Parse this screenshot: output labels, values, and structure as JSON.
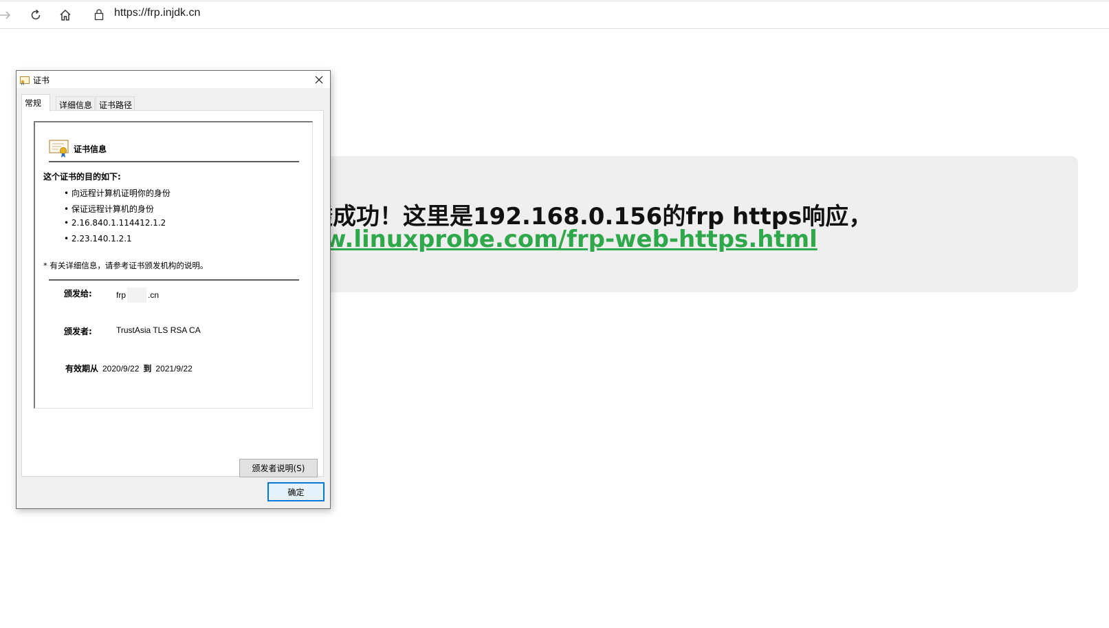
{
  "browser": {
    "url": "https://frp.injdk.cn"
  },
  "page": {
    "headline": "透成功！这里是192.168.0.156的frp https响应，",
    "link_text": "vw.linuxprobe.com/frp-web-https.html"
  },
  "dialog": {
    "title": "证书",
    "tabs": [
      {
        "label": "常规"
      },
      {
        "label": "详细信息"
      },
      {
        "label": "证书路径"
      }
    ],
    "info_title": "证书信息",
    "purpose_title": "这个证书的目的如下:",
    "purposes": [
      "• 向远程计算机证明你的身份",
      "• 保证远程计算机的身份",
      "• 2.16.840.1.114412.1.2",
      "• 2.23.140.1.2.1"
    ],
    "note": "* 有关详细信息，请参考证书颁发机构的说明。",
    "issued_to_label": "颁发给:",
    "issued_to_prefix": "frp",
    "issued_to_suffix": ".cn",
    "issued_by_label": "颁发者:",
    "issued_by_value": "TrustAsia TLS RSA CA",
    "valid_from_label": "有效期从",
    "valid_from": "2020/9/22",
    "valid_to_label": "到",
    "valid_to": "2021/9/22",
    "issuer_statement_button": "颁发者说明(S)",
    "ok_button": "确定"
  },
  "icons": {
    "back": "forward-arrow-icon",
    "refresh": "refresh-icon",
    "home": "home-icon",
    "lock": "lock-icon",
    "close": "close-icon",
    "certificate": "certificate-icon"
  }
}
